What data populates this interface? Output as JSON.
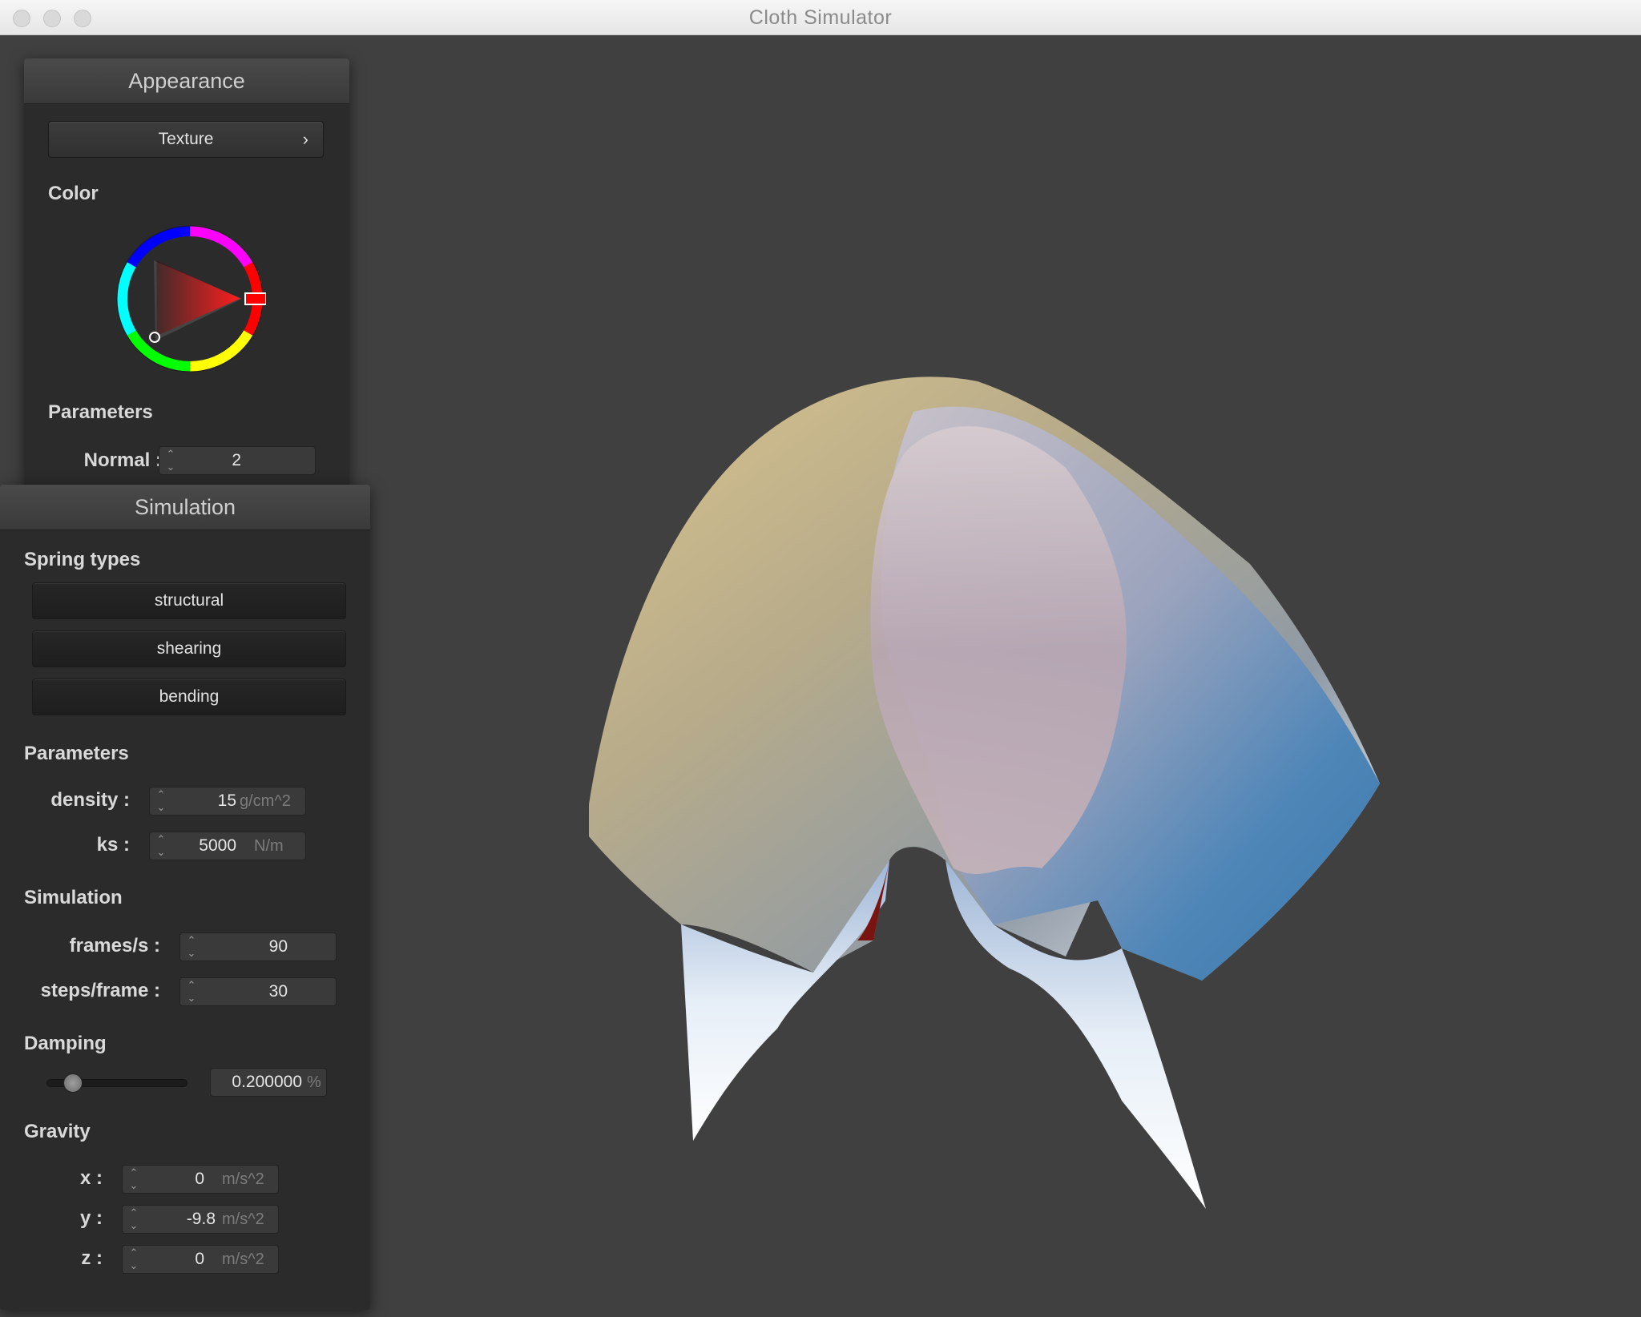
{
  "window": {
    "title": "Cloth Simulator"
  },
  "appearance": {
    "title": "Appearance",
    "texture_button": "Texture",
    "texture_chevron": "›",
    "color_label": "Color",
    "selected_color": "#ff0000",
    "parameters_label": "Parameters",
    "normal_label": "Normal :",
    "normal_value": "2"
  },
  "simulation": {
    "title": "Simulation",
    "spring_types_label": "Spring types",
    "spring_buttons": [
      "structural",
      "shearing",
      "bending"
    ],
    "parameters_label": "Parameters",
    "density": {
      "label": "density :",
      "value": "15",
      "unit": "g/cm^2"
    },
    "ks": {
      "label": "ks :",
      "value": "5000",
      "unit": "N/m"
    },
    "simulation_label": "Simulation",
    "fps": {
      "label": "frames/s :",
      "value": "90"
    },
    "steps": {
      "label": "steps/frame :",
      "value": "30"
    },
    "damping_label": "Damping",
    "damping": {
      "value": "0.200000",
      "unit": "%",
      "slider_fraction": 0.2
    },
    "gravity_label": "Gravity",
    "gravity": [
      {
        "label": "x :",
        "value": "0",
        "unit": "m/s^2"
      },
      {
        "label": "y :",
        "value": "-9.8",
        "unit": "m/s^2"
      },
      {
        "label": "z :",
        "value": "0",
        "unit": "m/s^2"
      }
    ]
  },
  "colors": {
    "background": "#404040",
    "panel": "#2b2b2b",
    "accent": "#ff0000"
  },
  "icons": [
    "close-button-icon",
    "minimize-button-icon",
    "zoom-button-icon",
    "chevron-right-icon",
    "spinner-arrows-icon"
  ]
}
